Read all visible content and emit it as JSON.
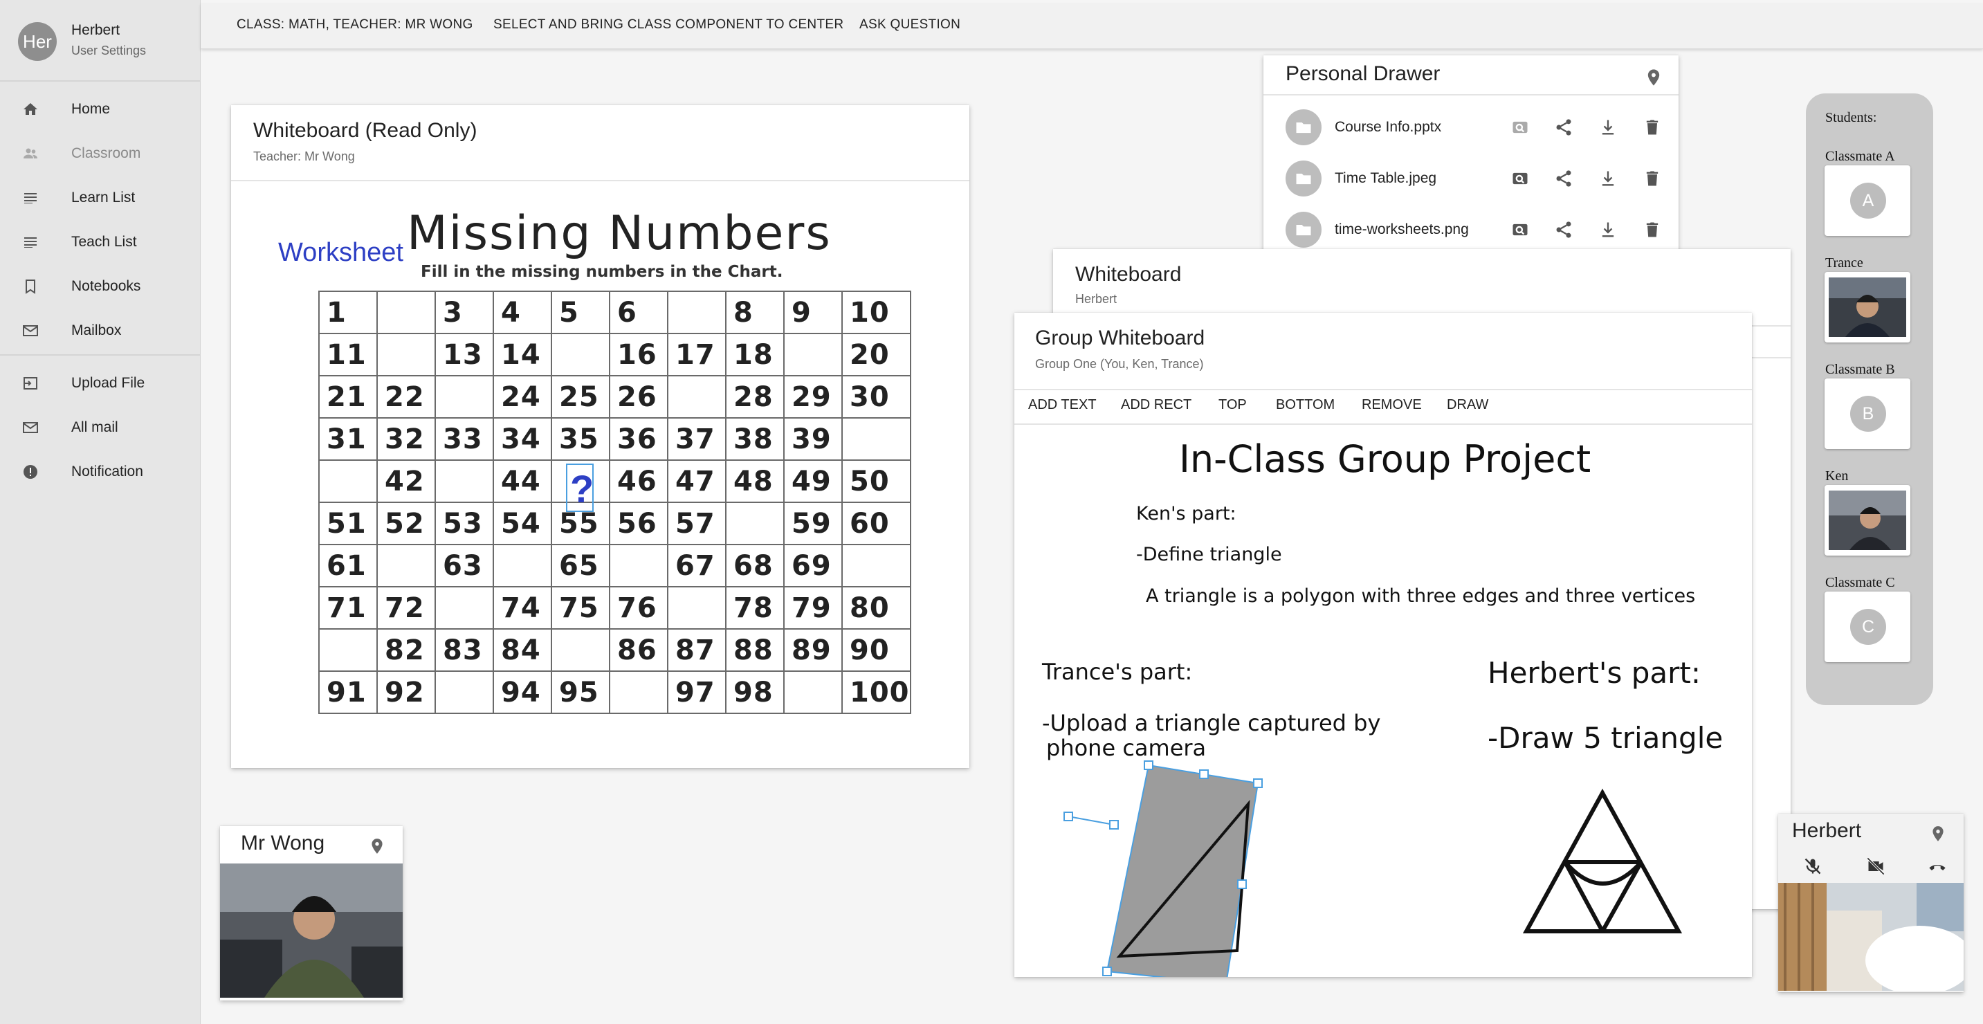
{
  "user": {
    "avatar_text": "Her",
    "name": "Herbert",
    "settings_label": "User Settings"
  },
  "nav": {
    "home": "Home",
    "classroom": "Classroom",
    "learn_list": "Learn List",
    "teach_list": "Teach List",
    "notebooks": "Notebooks",
    "mailbox": "Mailbox",
    "upload_file": "Upload File",
    "all_mail": "All mail",
    "notification": "Notification"
  },
  "topbar": {
    "class_info": "CLASS: MATH, TEACHER: MR WONG",
    "bring_center": "SELECT AND BRING CLASS COMPONENT TO CENTER",
    "ask_question": "ASK QUESTION"
  },
  "teacher_whiteboard": {
    "title": "Whiteboard (Read Only)",
    "subtitle": "Teacher: Mr Wong",
    "worksheet_label": "Worksheet",
    "heading": "Missing Numbers",
    "instruction": "Fill in the missing numbers in the Chart.",
    "question_mark": "?",
    "rows": [
      [
        "1",
        "",
        "3",
        "4",
        "5",
        "6",
        "",
        "8",
        "9",
        "10"
      ],
      [
        "11",
        "",
        "13",
        "14",
        "",
        "16",
        "17",
        "18",
        "",
        "20"
      ],
      [
        "21",
        "22",
        "",
        "24",
        "25",
        "26",
        "",
        "28",
        "29",
        "30"
      ],
      [
        "31",
        "32",
        "33",
        "34",
        "35",
        "36",
        "37",
        "38",
        "39",
        ""
      ],
      [
        "",
        "42",
        "",
        "44",
        "",
        "46",
        "47",
        "48",
        "49",
        "50"
      ],
      [
        "51",
        "52",
        "53",
        "54",
        "55",
        "56",
        "57",
        "",
        "59",
        "60"
      ],
      [
        "61",
        "",
        "63",
        "",
        "65",
        "",
        "67",
        "68",
        "69",
        ""
      ],
      [
        "71",
        "72",
        "",
        "74",
        "75",
        "76",
        "",
        "78",
        "79",
        "80"
      ],
      [
        "",
        "82",
        "83",
        "84",
        "",
        "86",
        "87",
        "88",
        "89",
        "90"
      ],
      [
        "91",
        "92",
        "",
        "94",
        "95",
        "",
        "97",
        "98",
        "",
        "100"
      ]
    ]
  },
  "personal_drawer": {
    "title": "Personal Drawer",
    "files": [
      {
        "name": "Course Info.pptx"
      },
      {
        "name": "Time Table.jpeg"
      },
      {
        "name": "time-worksheets.png"
      }
    ]
  },
  "personal_whiteboard": {
    "title": "Whiteboard",
    "subtitle": "Herbert"
  },
  "group_whiteboard": {
    "title": "Group Whiteboard",
    "subtitle": "Group One (You, Ken, Trance)",
    "toolbar": [
      "ADD TEXT",
      "ADD RECT",
      "TOP",
      "BOTTOM",
      "REMOVE",
      "DRAW"
    ],
    "heading": "In-Class Group Project",
    "ken_part": "Ken's part:",
    "ken_task": "-Define triangle",
    "ken_def": "A triangle is a polygon with three edges and three vertices",
    "trance_part": "Trance's part:",
    "trance_task_1": "-Upload a triangle captured by",
    "trance_task_2": "phone camera",
    "herbert_part": "Herbert's part:",
    "herbert_task": "-Draw 5 triangle"
  },
  "students": {
    "title": "Students:",
    "list": [
      {
        "name": "Classmate A",
        "initial": "A"
      },
      {
        "name": "Trance",
        "initial": ""
      },
      {
        "name": "Classmate B",
        "initial": "B"
      },
      {
        "name": "Ken",
        "initial": ""
      },
      {
        "name": "Classmate C",
        "initial": "C"
      }
    ]
  },
  "teacher_video": {
    "name": "Mr Wong"
  },
  "self_video": {
    "name": "Herbert"
  },
  "colors": {
    "sidebar": "#e6e6e6",
    "accent_blue": "#2a6fdb",
    "worksheet_blue": "#2d3fc4",
    "selection": "#4a9fe0"
  }
}
